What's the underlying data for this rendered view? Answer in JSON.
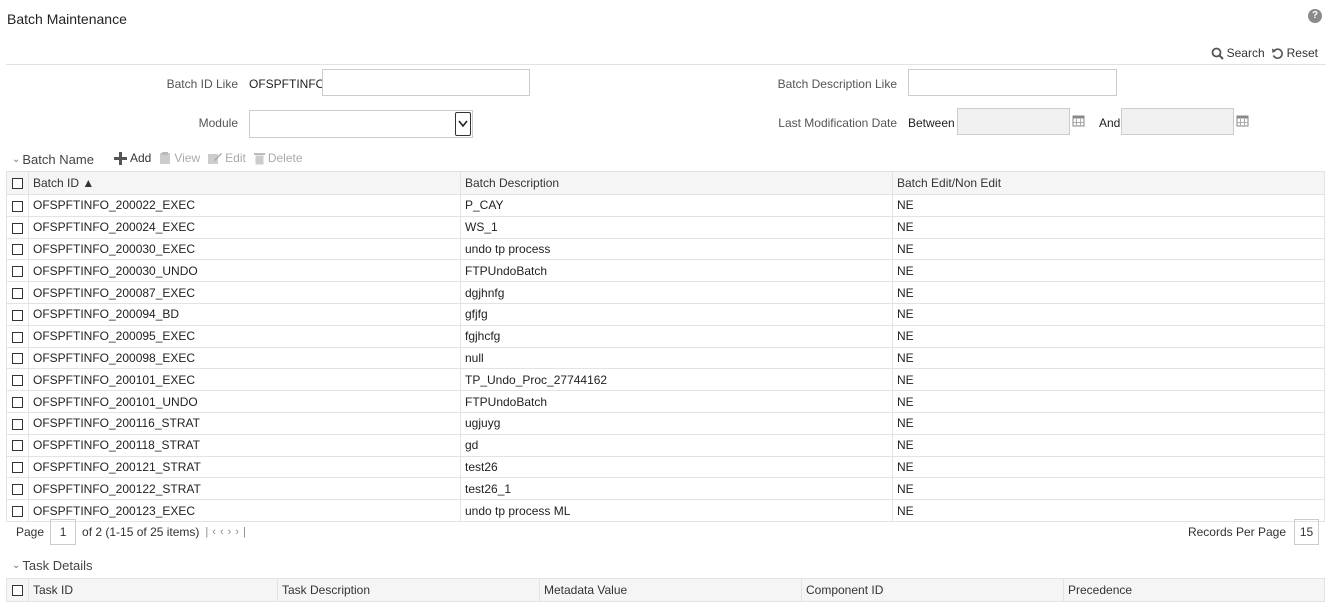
{
  "page": {
    "title": "Batch Maintenance",
    "help_glyph": "?"
  },
  "toolbar": {
    "search_label": "Search",
    "reset_label": "Reset"
  },
  "filters": {
    "batch_id_label": "Batch ID Like",
    "batch_id_prefix": "OFSPFTINFO_",
    "batch_id_value": "",
    "batch_desc_label": "Batch Description Like",
    "batch_desc_value": "",
    "module_label": "Module",
    "module_value": "",
    "last_mod_label": "Last Modification Date",
    "between_label": "Between",
    "and_label": "And",
    "date_from": "",
    "date_to": ""
  },
  "batch_section": {
    "title": "Batch Name",
    "actions": {
      "add": "Add",
      "view": "View",
      "edit": "Edit",
      "delete": "Delete"
    },
    "columns": [
      "Batch ID ▲",
      "Batch Description",
      "Batch Edit/Non Edit"
    ],
    "rows": [
      [
        "OFSPFTINFO_200022_EXEC",
        "P_CAY",
        "NE"
      ],
      [
        "OFSPFTINFO_200024_EXEC",
        "WS_1",
        "NE"
      ],
      [
        "OFSPFTINFO_200030_EXEC",
        "undo tp process",
        "NE"
      ],
      [
        "OFSPFTINFO_200030_UNDO",
        "FTPUndoBatch",
        "NE"
      ],
      [
        "OFSPFTINFO_200087_EXEC",
        "dgjhnfg",
        "NE"
      ],
      [
        "OFSPFTINFO_200094_BD",
        "gfjfg",
        "NE"
      ],
      [
        "OFSPFTINFO_200095_EXEC",
        "fgjhcfg",
        "NE"
      ],
      [
        "OFSPFTINFO_200098_EXEC",
        "null",
        "NE"
      ],
      [
        "OFSPFTINFO_200101_EXEC",
        "TP_Undo_Proc_27744162",
        "NE"
      ],
      [
        "OFSPFTINFO_200101_UNDO",
        "FTPUndoBatch",
        "NE"
      ],
      [
        "OFSPFTINFO_200116_STRAT",
        "ugjuyg",
        "NE"
      ],
      [
        "OFSPFTINFO_200118_STRAT",
        "gd",
        "NE"
      ],
      [
        "OFSPFTINFO_200121_STRAT",
        "test26",
        "NE"
      ],
      [
        "OFSPFTINFO_200122_STRAT",
        "test26_1",
        "NE"
      ],
      [
        "OFSPFTINFO_200123_EXEC",
        "undo tp process ML",
        "NE"
      ]
    ]
  },
  "pager": {
    "page_label": "Page",
    "page_value": "1",
    "page_info": "of 2 (1-15 of 25 items)",
    "records_per_page_label": "Records Per Page",
    "records_per_page_value": "15"
  },
  "task_section": {
    "title": "Task Details",
    "columns": [
      "Task ID",
      "Task Description",
      "Metadata Value",
      "Component ID",
      "Precedence"
    ]
  }
}
